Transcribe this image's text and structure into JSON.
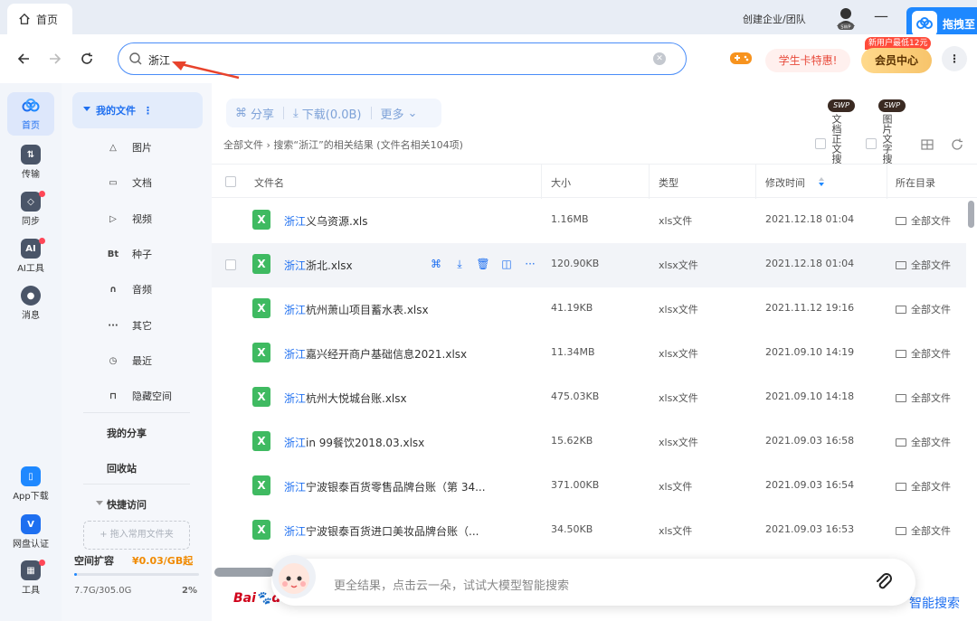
{
  "tab": {
    "label": "首页"
  },
  "titlebar": {
    "create_team": "创建企业/团队",
    "drag_panel": "拖拽至",
    "swp_tag": "SWP"
  },
  "search": {
    "value": "浙江"
  },
  "nav": {
    "student_btn": "学生卡特惠!",
    "vip_btn": "会员中心",
    "vip_tip": "新用户最低12元"
  },
  "rail": [
    {
      "label": "首页",
      "icon": "cloud-icon"
    },
    {
      "label": "传输",
      "icon": "transfer-icon"
    },
    {
      "label": "同步",
      "icon": "sync-icon"
    },
    {
      "label": "AI工具",
      "icon": "ai-icon"
    },
    {
      "label": "消息",
      "icon": "message-icon"
    },
    {
      "label": "App下载",
      "icon": "phone-icon"
    },
    {
      "label": "网盘认证",
      "icon": "verify-icon"
    },
    {
      "label": "工具",
      "icon": "tools-icon"
    }
  ],
  "sidebar": {
    "head": "我的文件",
    "items": [
      {
        "label": "图片",
        "icon": "image-icon"
      },
      {
        "label": "文档",
        "icon": "document-icon"
      },
      {
        "label": "视频",
        "icon": "video-icon"
      },
      {
        "label": "种子",
        "icon": "torrent-icon",
        "glyph": "Bt"
      },
      {
        "label": "音频",
        "icon": "headphones-icon"
      },
      {
        "label": "其它",
        "icon": "more-icon"
      },
      {
        "label": "最近",
        "icon": "clock-icon"
      },
      {
        "label": "隐藏空间",
        "icon": "lock-icon"
      }
    ],
    "my_share": "我的分享",
    "recycle": "回收站",
    "quick_access": "快捷访问",
    "pin_placeholder": "+ 拖入常用文件夹",
    "space_label": "空间扩容",
    "space_price": "¥0.03/GB起",
    "space_used": "7.7G/305.0G",
    "space_pct": "2%",
    "space_fraction": 0.025
  },
  "toolbar": {
    "share": "分享",
    "download": "下载(0.0B)",
    "more": "更多"
  },
  "breadcrumb": "全部文件 › 搜索“浙江”的相关结果 (文件名相关104项)",
  "filters": [
    {
      "tag": "SWP",
      "label": "文档正文搜"
    },
    {
      "tag": "SWP",
      "label": "图片文字搜"
    }
  ],
  "table": {
    "headers": {
      "name": "文件名",
      "size": "大小",
      "type": "类型",
      "modified": "修改时间",
      "dir": "所在目录"
    },
    "rows": [
      {
        "hl": "浙江",
        "rest": "义乌资源.xls",
        "size": "1.16MB",
        "type": "xls文件",
        "time": "2021.12.18 01:04",
        "dir": "全部文件"
      },
      {
        "hl": "浙江",
        "rest": "浙北.xlsx",
        "size": "120.90KB",
        "type": "xlsx文件",
        "time": "2021.12.18 01:04",
        "dir": "全部文件"
      },
      {
        "hl": "浙江",
        "rest": "杭州萧山项目蓄水表.xlsx",
        "size": "41.19KB",
        "type": "xlsx文件",
        "time": "2021.11.12 19:16",
        "dir": "全部文件"
      },
      {
        "hl": "浙江",
        "rest": "嘉兴经开商户基础信息2021.xlsx",
        "size": "11.34MB",
        "type": "xlsx文件",
        "time": "2021.09.10 14:19",
        "dir": "全部文件"
      },
      {
        "hl": "浙江",
        "rest": "杭州大悦城台账.xlsx",
        "size": "475.03KB",
        "type": "xlsx文件",
        "time": "2021.09.10 14:18",
        "dir": "全部文件"
      },
      {
        "hl": "浙江",
        "rest": "in 99餐饮2018.03.xlsx",
        "size": "15.62KB",
        "type": "xlsx文件",
        "time": "2021.09.03 16:58",
        "dir": "全部文件"
      },
      {
        "hl": "浙江",
        "rest": "宁波银泰百货零售品牌台账（第 34...",
        "size": "371.00KB",
        "type": "xls文件",
        "time": "2021.09.03 16:54",
        "dir": "全部文件"
      },
      {
        "hl": "浙江",
        "rest": "宁波银泰百货进口美妆品牌台账（...",
        "size": "34.50KB",
        "type": "xls文件",
        "time": "2021.09.03 16:53",
        "dir": "全部文件"
      }
    ]
  },
  "ai_bar": {
    "placeholder": "更全结果，点击云一朵，试试大模型智能搜索",
    "ai_search": "智能搜索"
  },
  "baidu_logo": "Bai du"
}
